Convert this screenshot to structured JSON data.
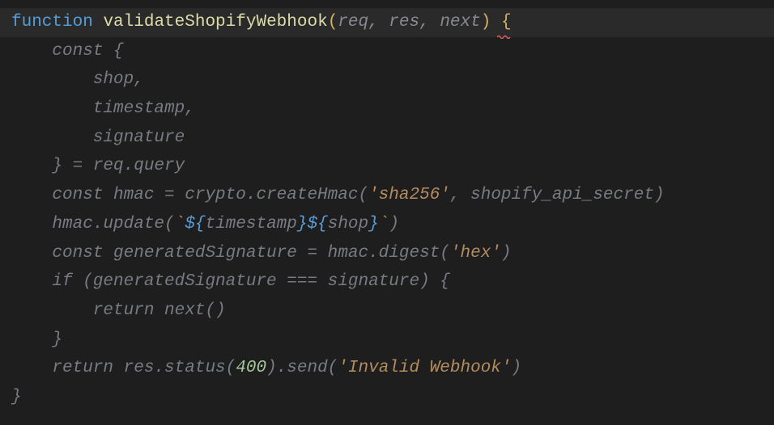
{
  "code": {
    "l1_kw": "function",
    "l1_fn": "validateShopifyWebhook",
    "l1_params": "req, res, next",
    "l2": "    const {",
    "l3": "        shop,",
    "l4": "        timestamp,",
    "l5": "        signature",
    "l6": "    } = req.query",
    "l7_a": "    const hmac = crypto.createHmac(",
    "l7_s1": "'sha256'",
    "l7_c": ", shopify_api_secret)",
    "l8_a": "    hmac.update(",
    "l8_tick": "`",
    "l8_e1o": "${",
    "l8_e1": "timestamp",
    "l8_e1c": "}",
    "l8_e2o": "${",
    "l8_e2": "shop",
    "l8_e2c": "}",
    "l8_tick2": "`",
    "l8_end": ")",
    "l9_a": "    const generatedSignature = hmac.digest(",
    "l9_s": "'hex'",
    "l9_end": ")",
    "l10": "    if (generatedSignature === signature) {",
    "l11": "        return next()",
    "l12": "    }",
    "l13_a": "    return res.status(",
    "l13_n": "400",
    "l13_b": ").send(",
    "l13_s": "'Invalid Webhook'",
    "l13_end": ")",
    "l14": "}"
  }
}
